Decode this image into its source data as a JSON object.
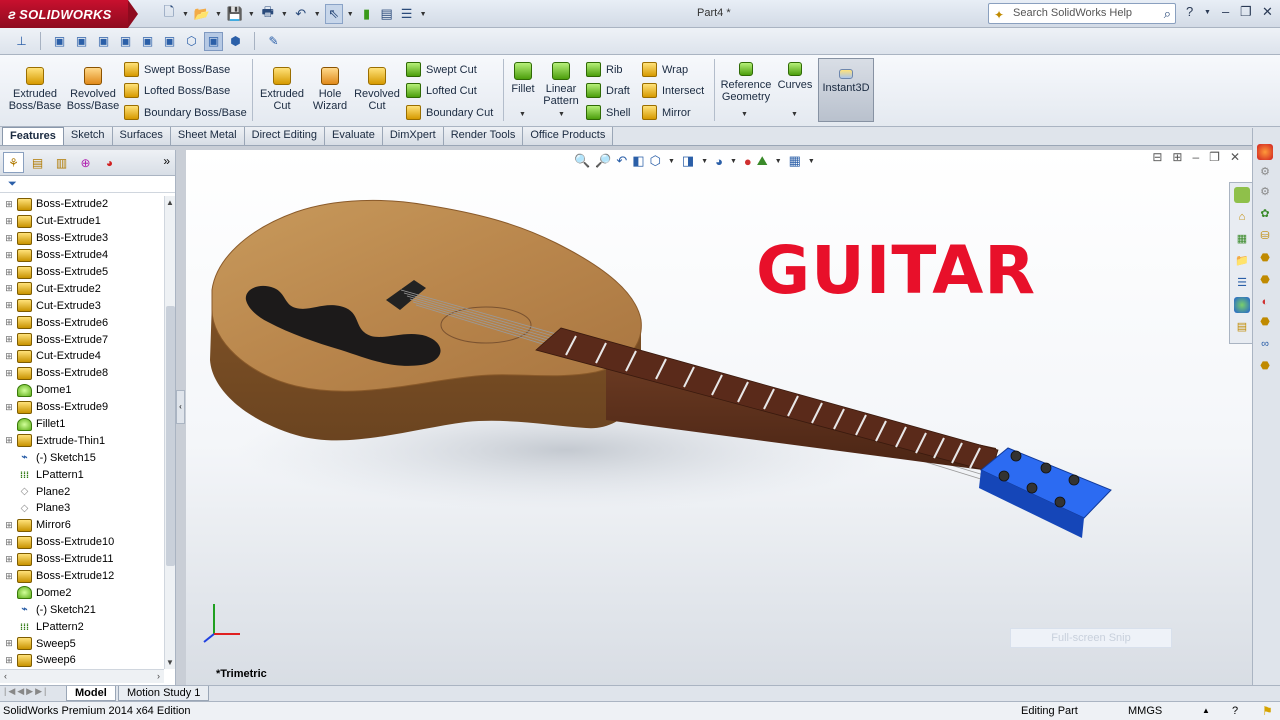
{
  "app": {
    "brand": "SOLIDWORKS",
    "doc_title": "Part4 *"
  },
  "search": {
    "placeholder": "Search SolidWorks Help"
  },
  "ribbon": {
    "extruded_boss": "Extruded Boss/Base",
    "revolved_boss": "Revolved Boss/Base",
    "swept_boss": "Swept Boss/Base",
    "lofted_boss": "Lofted Boss/Base",
    "boundary_boss": "Boundary Boss/Base",
    "extruded_cut": "Extruded Cut",
    "hole_wizard": "Hole Wizard",
    "revolved_cut": "Revolved Cut",
    "swept_cut": "Swept Cut",
    "lofted_cut": "Lofted Cut",
    "boundary_cut": "Boundary Cut",
    "fillet": "Fillet",
    "linear_pattern": "Linear Pattern",
    "rib": "Rib",
    "draft": "Draft",
    "shell": "Shell",
    "wrap": "Wrap",
    "intersect": "Intersect",
    "mirror": "Mirror",
    "reference_geometry": "Reference Geometry",
    "curves": "Curves",
    "instant3d": "Instant3D"
  },
  "tabs": [
    "Features",
    "Sketch",
    "Surfaces",
    "Sheet Metal",
    "Direct Editing",
    "Evaluate",
    "DimXpert",
    "Render Tools",
    "Office Products"
  ],
  "tree": [
    {
      "label": "Boss-Extrude2",
      "icon": "boss"
    },
    {
      "label": "Cut-Extrude1",
      "icon": "boss"
    },
    {
      "label": "Boss-Extrude3",
      "icon": "boss"
    },
    {
      "label": "Boss-Extrude4",
      "icon": "boss"
    },
    {
      "label": "Boss-Extrude5",
      "icon": "boss"
    },
    {
      "label": "Cut-Extrude2",
      "icon": "boss"
    },
    {
      "label": "Cut-Extrude3",
      "icon": "boss"
    },
    {
      "label": "Boss-Extrude6",
      "icon": "boss"
    },
    {
      "label": "Boss-Extrude7",
      "icon": "boss"
    },
    {
      "label": "Cut-Extrude4",
      "icon": "boss"
    },
    {
      "label": "Boss-Extrude8",
      "icon": "boss"
    },
    {
      "label": "Dome1",
      "icon": "dome"
    },
    {
      "label": "Boss-Extrude9",
      "icon": "boss"
    },
    {
      "label": "Fillet1",
      "icon": "dome"
    },
    {
      "label": "Extrude-Thin1",
      "icon": "boss"
    },
    {
      "label": "(-) Sketch15",
      "icon": "sketch"
    },
    {
      "label": "LPattern1",
      "icon": "pattern"
    },
    {
      "label": "Plane2",
      "icon": "plane"
    },
    {
      "label": "Plane3",
      "icon": "plane"
    },
    {
      "label": "Mirror6",
      "icon": "boss"
    },
    {
      "label": "Boss-Extrude10",
      "icon": "boss"
    },
    {
      "label": "Boss-Extrude11",
      "icon": "boss"
    },
    {
      "label": "Boss-Extrude12",
      "icon": "boss"
    },
    {
      "label": "Dome2",
      "icon": "dome"
    },
    {
      "label": "(-) Sketch21",
      "icon": "sketch"
    },
    {
      "label": "LPattern2",
      "icon": "pattern"
    },
    {
      "label": "Sweep5",
      "icon": "boss"
    },
    {
      "label": "Sweep6",
      "icon": "boss"
    }
  ],
  "viewport": {
    "overlay_title": "GUITAR",
    "orientation": "*Trimetric",
    "snip": "Full-screen Snip"
  },
  "bottom_tabs": {
    "model": "Model",
    "motion": "Motion Study 1"
  },
  "status": {
    "edition": "SolidWorks Premium 2014 x64 Edition",
    "mode": "Editing Part",
    "units": "MMGS"
  },
  "colors": {
    "accent_red": "#e8102a",
    "wood": "#b9864c",
    "headstock": "#1f5fe0"
  }
}
